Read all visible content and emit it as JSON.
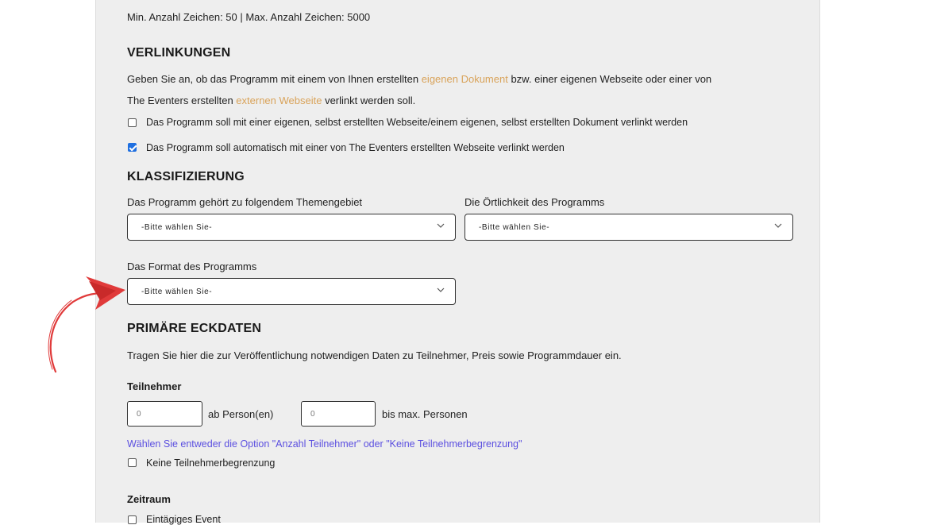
{
  "char_limits": "Min. Anzahl Zeichen: 50 | Max. Anzahl Zeichen: 5000",
  "links": {
    "heading": "VERLINKUNGEN",
    "desc_1a": "Geben Sie an, ob das Programm mit einem von Ihnen erstellten ",
    "desc_link_own": "eigenen Dokument",
    "desc_1b": " bzw. einer eigenen Webseite oder einer von",
    "desc_2a": "The Eventers erstellten ",
    "desc_link_ext": "externen Webseite",
    "desc_2b": " verlinkt werden soll.",
    "option_own": "Das Programm soll mit einer eigenen, selbst erstellten Webseite/einem eigenen, selbst erstellten Dokument verlinkt werden",
    "option_auto": "Das Programm soll automatisch mit einer von The Eventers erstellten Webseite verlinkt werden",
    "option_own_checked": false,
    "option_auto_checked": true
  },
  "classification": {
    "heading": "KLASSIFIZIERUNG",
    "topic_label": "Das Programm gehört zu folgendem Themengebiet",
    "topic_value": "-Bitte wählen Sie-",
    "location_label": "Die Örtlichkeit des Programms",
    "location_value": "-Bitte wählen Sie-",
    "format_label": "Das Format des Programms",
    "format_value": "-Bitte wählen Sie-"
  },
  "primary": {
    "heading": "PRIMÄRE ECKDATEN",
    "desc": "Tragen Sie hier die zur Veröffentlichung notwendigen Daten zu Teilnehmer, Preis sowie Programmdauer ein.",
    "participants_label": "Teilnehmer",
    "min_value": "0",
    "min_suffix": "ab Person(en)",
    "max_value": "0",
    "max_suffix": "bis max. Personen",
    "hint": "Wählen Sie entweder die Option \"Anzahl Teilnehmer\" oder \"Keine Teilnehmerbegrenzung\"",
    "no_limit": "Keine Teilnehmerbegrenzung",
    "period_label": "Zeitraum",
    "single_day": "Eintägiges Event"
  },
  "colors": {
    "panel_bg": "#eeeeee",
    "link_orange": "#d9a35a",
    "hint_blue": "#5b4fe0",
    "checkbox_blue": "#1f6fe0",
    "arrow_red": "#e03a3a"
  },
  "icons": [
    "chevron-down-icon",
    "checkmark-icon",
    "annotation-arrow-icon"
  ]
}
